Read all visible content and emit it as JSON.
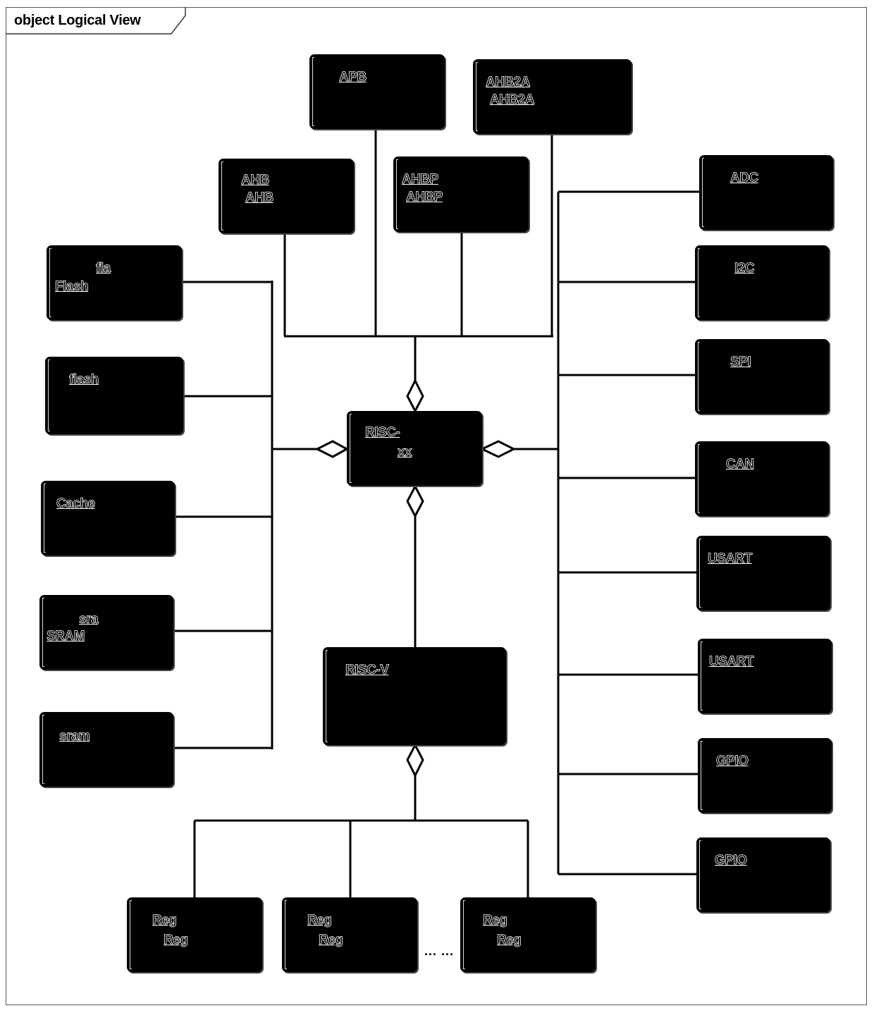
{
  "diagram": {
    "title": "object Logical View",
    "center": {
      "line1": "RISC-",
      "line2": "xx",
      "name": "risc-core"
    },
    "lower": {
      "line1": "RISC-V",
      "name": "risc-v-registers"
    },
    "top_row": [
      {
        "line1": "APB",
        "line2": "",
        "name": "apb"
      },
      {
        "line1": "AHB2A",
        "line2": "AHB2A",
        "name": "ahb2a"
      }
    ],
    "second_row": [
      {
        "line1": "AHB",
        "line2": "AHB",
        "name": "ahb"
      },
      {
        "line1": "AHBP",
        "line2": "AHBP",
        "name": "ahbp"
      }
    ],
    "left": [
      {
        "line1": "fla",
        "line2": "Flash",
        "name": "flash-1"
      },
      {
        "line1": "flash",
        "line2": "",
        "name": "flash-2"
      },
      {
        "line1": "Cache",
        "line2": "",
        "name": "cache"
      },
      {
        "line1": "sra",
        "line2": "SRAM",
        "name": "sram-1"
      },
      {
        "line1": "sram",
        "line2": "",
        "name": "sram-2"
      }
    ],
    "right": [
      {
        "line1": "ADC",
        "name": "adc"
      },
      {
        "line1": "I2C",
        "name": "i2c"
      },
      {
        "line1": "SPI",
        "name": "spi"
      },
      {
        "line1": "CAN",
        "name": "can"
      },
      {
        "line1": "USART",
        "name": "usart-1"
      },
      {
        "line1": "USART",
        "name": "usart-2"
      },
      {
        "line1": "GPIO",
        "name": "gpio-1"
      },
      {
        "line1": "GPIO",
        "name": "gpio-2"
      }
    ],
    "bottom": [
      {
        "line1": "Reg",
        "line2": "Reg",
        "name": "register-1"
      },
      {
        "line1": "Reg",
        "line2": "Reg",
        "name": "register-2"
      },
      {
        "line1": "Reg",
        "line2": "Reg",
        "name": "register-n"
      }
    ],
    "ellipsis": "... ..."
  }
}
